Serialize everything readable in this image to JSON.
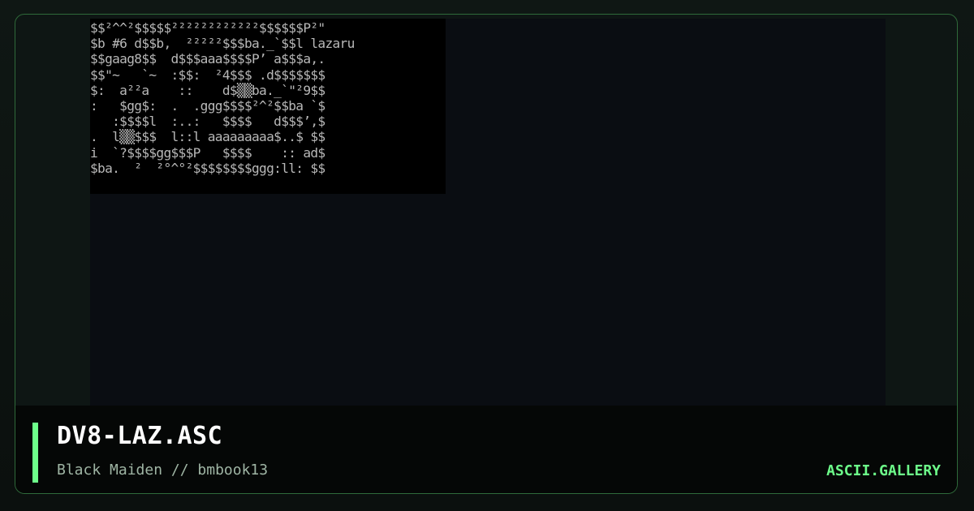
{
  "art": {
    "lines": [
      "$$²^^²$$$$$²²²²²²²²²²²²$$$$$$P²\"",
      "$b #6 d$$b,  ²²²²²$$$ba._`$$l lazaru",
      "$$gaag8$$  d$$$aaa$$$$P’ a$$$a,.",
      "$$\"~   `~  :$$:  ²4$$$ .d$$$$$$$",
      "$:  a²²a    ::    d$▒▒ba._`\"²9$$",
      ":   $gg$:  .  .ggg$$$$²^²$$ba `$",
      "   :$$$$l  :..:   $$$$   d$$$’,$",
      ".  l▒▒$$$  l::l aaaaaaaaa$..$ $$",
      "i  `?$$$$gg$$$P   $$$$    :: ad$",
      "$ba.  ²  ²°^°²$$$$$$$$ggg:ll: $$"
    ]
  },
  "footer": {
    "title": "DV8-LAZ.ASC",
    "subtitle": "Black Maiden // bmbook13",
    "brand": "ASCII.GALLERY"
  },
  "colors": {
    "accent": "#6dff8a",
    "frame_border": "#2f6a3a",
    "art_text": "#b8b8b8"
  }
}
